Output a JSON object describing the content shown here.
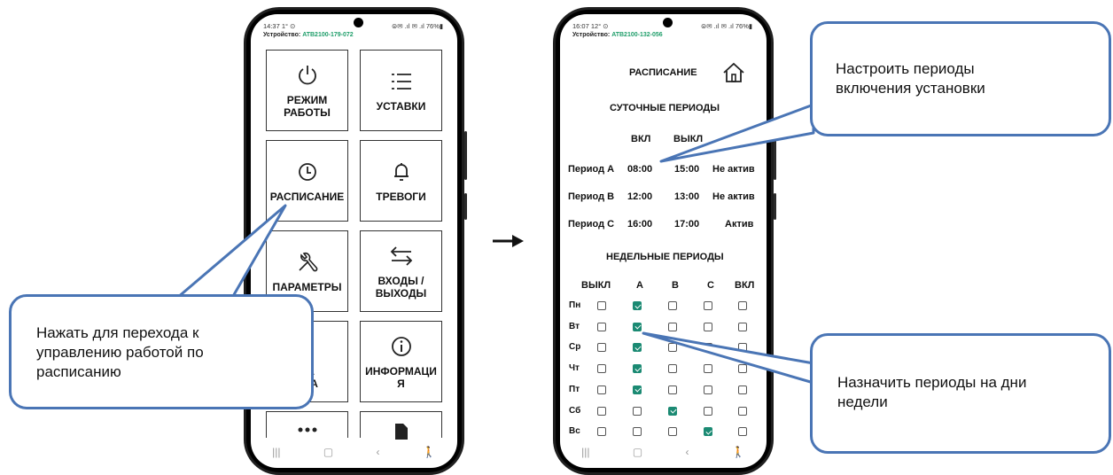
{
  "left_phone": {
    "status_time": "14:37 1° ⊙",
    "status_signal": "⊜✉ .ıl ✉ .ıl 76%▮",
    "device_label": "Устройство:",
    "device_id": "ATB2100-179-072",
    "tiles": [
      {
        "label": "РЕЖИМ\nРАБОТЫ",
        "icon": "power-icon"
      },
      {
        "label": "УСТАВКИ",
        "icon": "list-icon"
      },
      {
        "label": "РАСПИСАНИЕ",
        "icon": "clock-icon"
      },
      {
        "label": "ТРЕВОГИ",
        "icon": "bell-icon"
      },
      {
        "label": "ПАРАМЕТРЫ",
        "icon": "tools-icon"
      },
      {
        "label": "ВХОДЫ /\nВЫХОДЫ",
        "icon": "arrows-icon"
      },
      {
        "label": "ВА\nУПА",
        "icon": "key-icon"
      },
      {
        "label": "ИНФОРМАЦИ\nЯ",
        "icon": "info-icon"
      },
      {
        "label": "",
        "icon": "more-icon"
      },
      {
        "label": "",
        "icon": "document-icon"
      }
    ],
    "nav": [
      "|||",
      "▢",
      "‹",
      "🚶"
    ]
  },
  "right_phone": {
    "status_time": "16:07 12° ⊙",
    "status_signal": "⊜✉ .ıl ✉ .ıl 76%▮",
    "device_label": "Устройство:",
    "device_id": "ATB2100-132-056",
    "title": "РАСПИСАНИЕ",
    "daily_header": "СУТОЧНЫЕ ПЕРИОДЫ",
    "col_on": "ВКЛ",
    "col_off": "ВЫКЛ",
    "col_status": "С",
    "periods": [
      {
        "name": "Период A",
        "on": "08:00",
        "off": "15:00",
        "status": "Не актив"
      },
      {
        "name": "Период B",
        "on": "12:00",
        "off": "13:00",
        "status": "Не актив"
      },
      {
        "name": "Период C",
        "on": "16:00",
        "off": "17:00",
        "status": "Актив"
      }
    ],
    "weekly_header": "НЕДЕЛЬНЫЕ ПЕРИОДЫ",
    "weekly_cols": [
      "ВЫКЛ",
      "A",
      "B",
      "C",
      "ВКЛ"
    ],
    "days": [
      {
        "day": "Пн",
        "checks": [
          false,
          true,
          false,
          false,
          false
        ]
      },
      {
        "day": "Вт",
        "checks": [
          false,
          true,
          false,
          false,
          false
        ]
      },
      {
        "day": "Ср",
        "checks": [
          false,
          true,
          false,
          false,
          false
        ]
      },
      {
        "day": "Чт",
        "checks": [
          false,
          true,
          false,
          false,
          false
        ]
      },
      {
        "day": "Пт",
        "checks": [
          false,
          true,
          false,
          false,
          false
        ]
      },
      {
        "day": "Сб",
        "checks": [
          false,
          false,
          true,
          false,
          false
        ]
      },
      {
        "day": "Вс",
        "checks": [
          false,
          false,
          false,
          true,
          false
        ]
      }
    ],
    "nav": [
      "|||",
      "▢",
      "‹",
      "🚶"
    ]
  },
  "callouts": {
    "left": [
      "Нажать для перехода к",
      "управлению работой по",
      "расписанию"
    ],
    "top_right": [
      "Настроить периоды",
      "включения установки"
    ],
    "bottom_right": [
      "Назначить периоды на дни",
      "недели"
    ]
  },
  "colors": {
    "callout_border": "#4a75b5",
    "check": "#1b8a73",
    "device_id": "#1f9e6a"
  }
}
